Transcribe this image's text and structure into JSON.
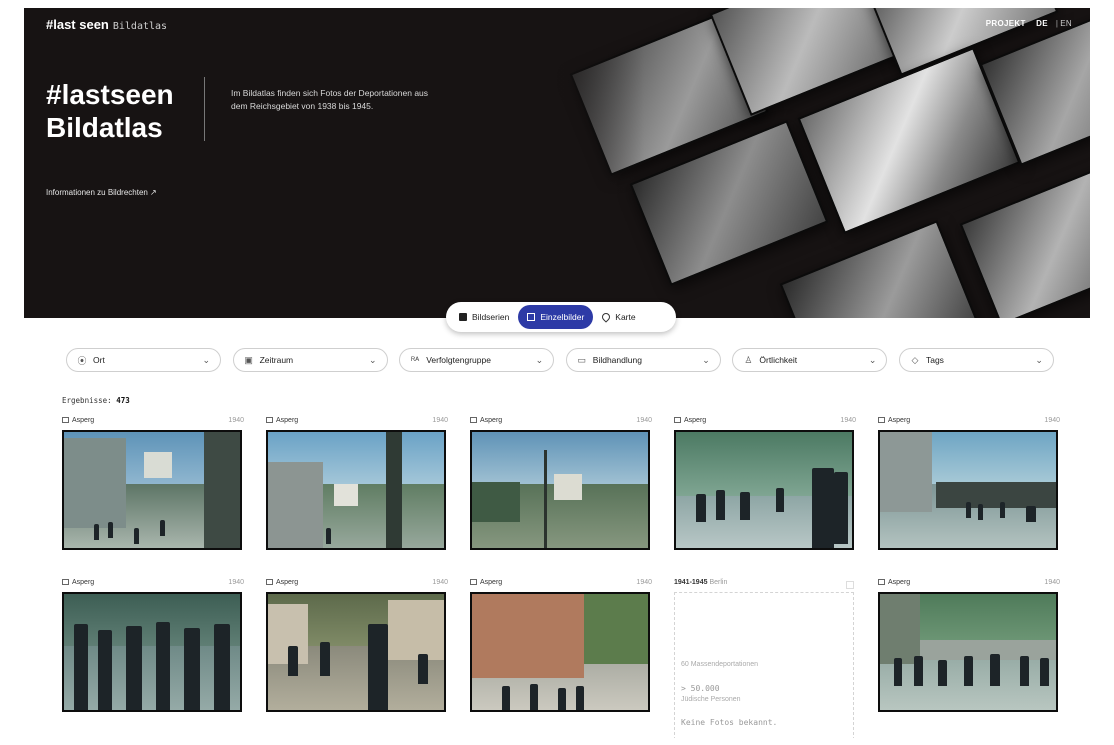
{
  "header": {
    "brand_main": "#last seen",
    "brand_sub": "Bildatlas",
    "nav_projekt": "PROJEKT",
    "lang_de": "DE",
    "lang_sep": "|",
    "lang_en": "EN"
  },
  "hero": {
    "title_line1": "#lastseen",
    "title_line2": "Bildatlas",
    "description": "Im Bildatlas finden sich Fotos der Deportationen aus dem Reichsgebiet von 1938 bis 1945.",
    "rights_link": "Informationen zu Bildrechten ↗"
  },
  "view_tabs": [
    {
      "label": "Bildserien",
      "active": false,
      "icon": "stack-icon"
    },
    {
      "label": "Einzelbilder",
      "active": true,
      "icon": "image-icon"
    },
    {
      "label": "Karte",
      "active": false,
      "icon": "map-pin-icon"
    }
  ],
  "filters": [
    {
      "label": "Ort",
      "icon": "⦿"
    },
    {
      "label": "Zeitraum",
      "icon": "▣"
    },
    {
      "label": "Verfolgtengruppe",
      "icon": "ᴿᴬ"
    },
    {
      "label": "Bildhandlung",
      "icon": "▭"
    },
    {
      "label": "Örtlichkeit",
      "icon": "♙"
    },
    {
      "label": "Tags",
      "icon": "◇"
    }
  ],
  "results": {
    "label": "Ergebnisse:",
    "count": "473"
  },
  "cards": [
    {
      "location": "Asperg",
      "year": "1940"
    },
    {
      "location": "Asperg",
      "year": "1940"
    },
    {
      "location": "Asperg",
      "year": "1940"
    },
    {
      "location": "Asperg",
      "year": "1940"
    },
    {
      "location": "Asperg",
      "year": "1940"
    },
    {
      "location": "Asperg",
      "year": "1940"
    },
    {
      "location": "Asperg",
      "year": "1940"
    },
    {
      "location": "Asperg",
      "year": "1940"
    },
    {
      "location": "Asperg",
      "year": "1940"
    }
  ],
  "placeholder_card": {
    "period": "1941-1945",
    "city": "Berlin",
    "line1": "60 Massendeportationen",
    "number": "> 50.000",
    "sub": "Jüdische Personen",
    "none": "Keine Fotos bekannt."
  },
  "colors": {
    "accent": "#2d3aa6",
    "hero_bg": "#171313"
  }
}
